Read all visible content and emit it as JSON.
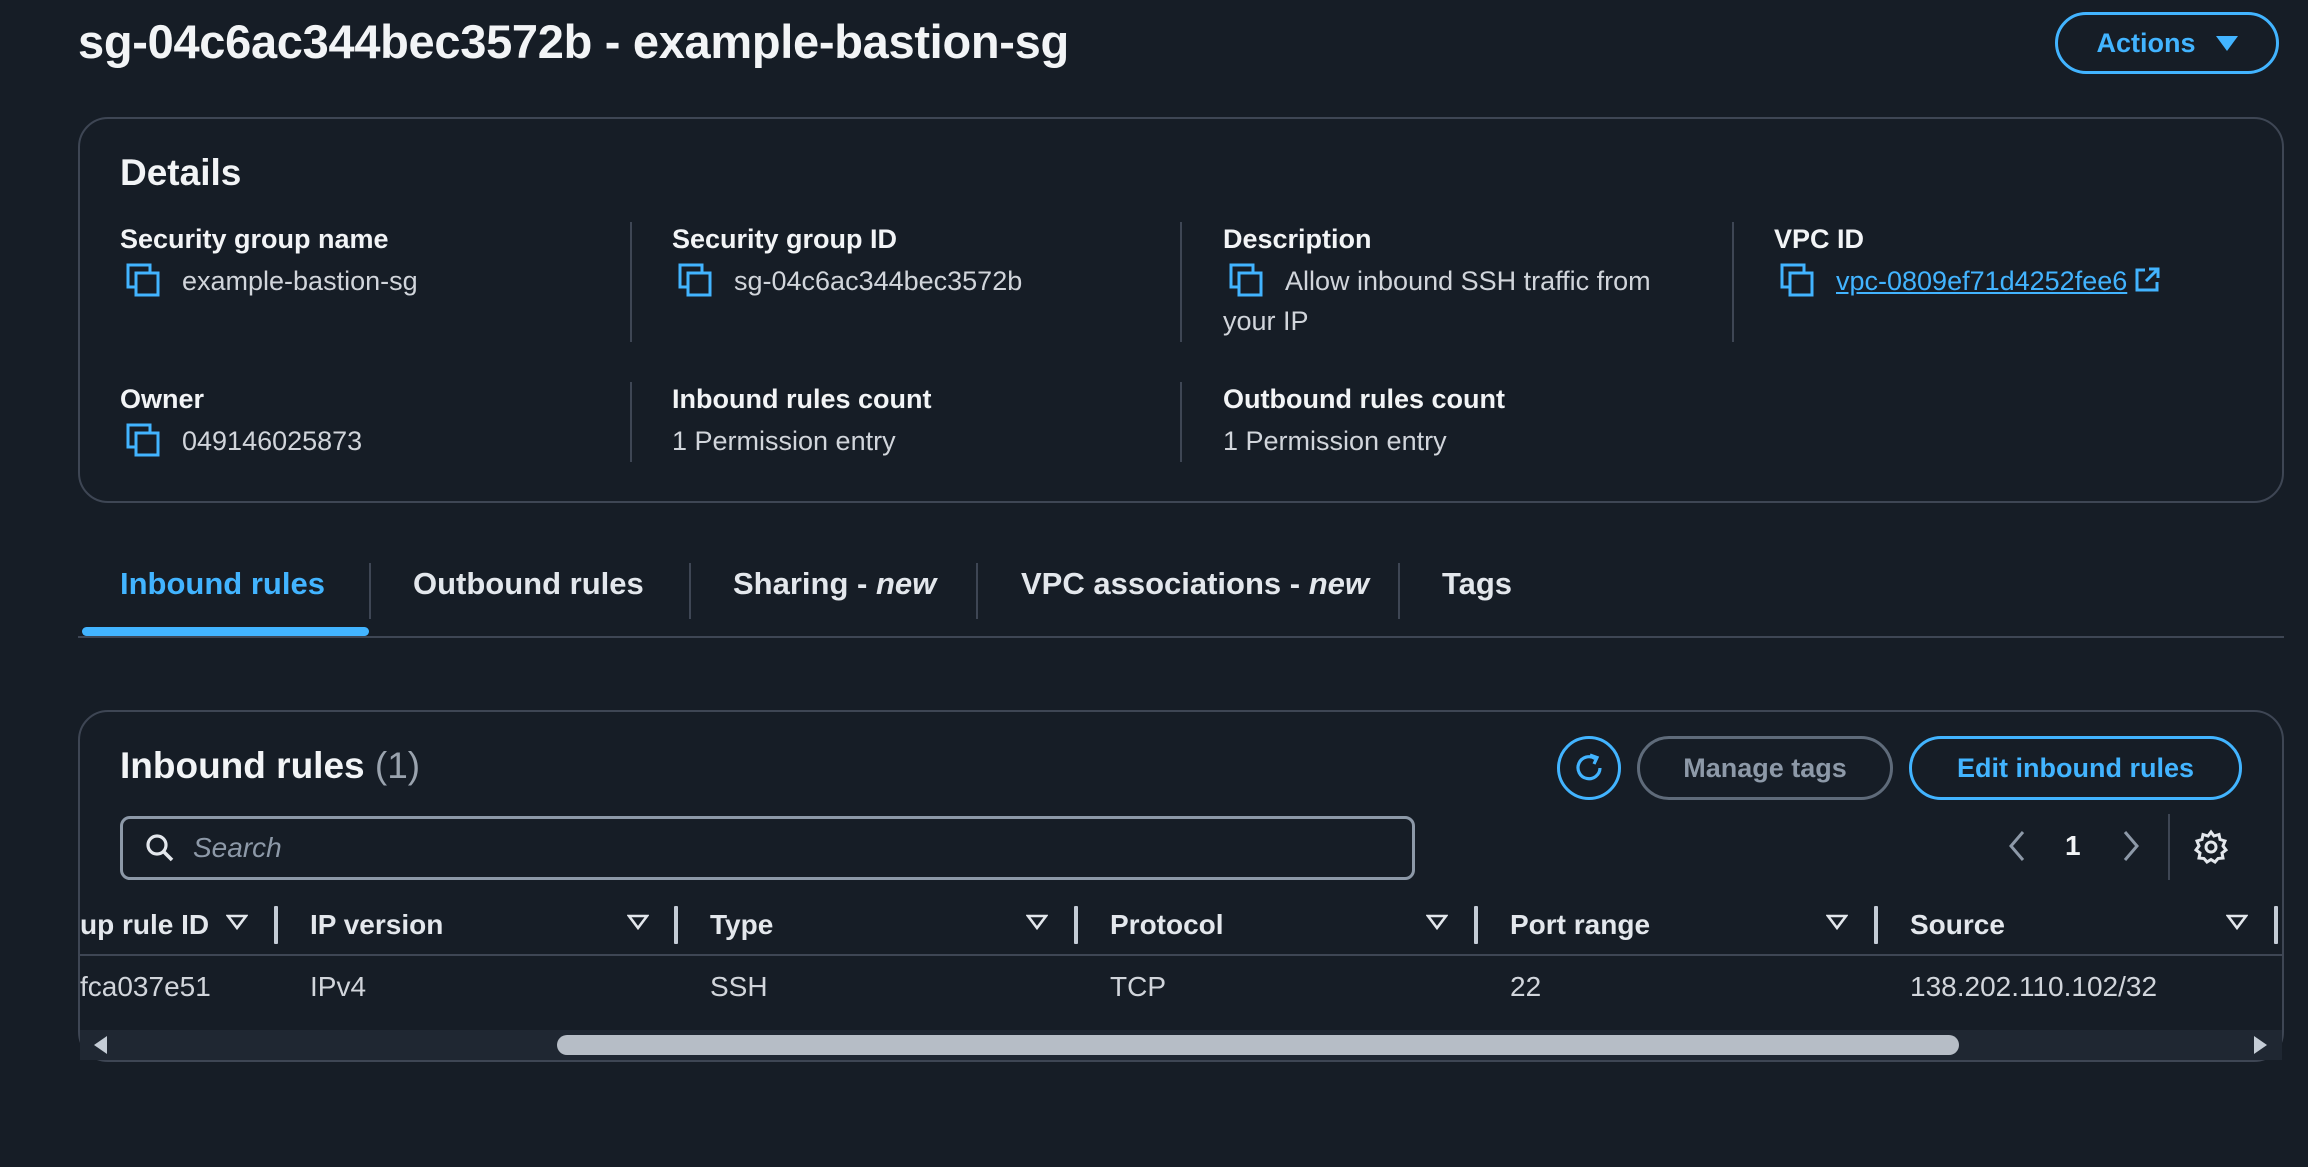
{
  "page": {
    "title": "sg-04c6ac344bec3572b - example-bastion-sg",
    "actions_label": "Actions"
  },
  "colors": {
    "background": "#161d26",
    "accent": "#42b4ff",
    "border": "#3e4654"
  },
  "details": {
    "title": "Details",
    "security_group_name": {
      "label": "Security group name",
      "value": "example-bastion-sg"
    },
    "security_group_id": {
      "label": "Security group ID",
      "value": "sg-04c6ac344bec3572b"
    },
    "description": {
      "label": "Description",
      "value_line1": "Allow inbound SSH traffic from",
      "value_line2": "your IP"
    },
    "vpc_id": {
      "label": "VPC ID",
      "value": "vpc-0809ef71d4252fee6"
    },
    "owner": {
      "label": "Owner",
      "value": "049146025873"
    },
    "inbound_rules_count": {
      "label": "Inbound rules count",
      "value": "1 Permission entry"
    },
    "outbound_rules_count": {
      "label": "Outbound rules count",
      "value": "1 Permission entry"
    }
  },
  "tabs": [
    {
      "label": "Inbound rules",
      "suffix": "",
      "active": true
    },
    {
      "label": "Outbound rules",
      "suffix": ""
    },
    {
      "label": "Sharing - ",
      "suffix": "new"
    },
    {
      "label": "VPC associations - ",
      "suffix": "new"
    },
    {
      "label": "Tags",
      "suffix": ""
    }
  ],
  "inbound": {
    "title": "Inbound rules",
    "count": "(1)",
    "manage_tags_label": "Manage tags",
    "edit_label": "Edit inbound rules",
    "search_placeholder": "Search",
    "page_number": "1",
    "columns": [
      "up rule ID",
      "IP version",
      "Type",
      "Protocol",
      "Port range",
      "Source"
    ],
    "rows": [
      [
        "fca037e51",
        "IPv4",
        "SSH",
        "TCP",
        "22",
        "138.202.110.102/32"
      ]
    ]
  },
  "icons": {
    "copy": "copy-icon",
    "external": "external-link-icon",
    "refresh": "refresh-icon",
    "search": "search-icon",
    "settings": "gear-icon",
    "caret": "caret-down-icon",
    "sort": "sort-caret-icon"
  }
}
